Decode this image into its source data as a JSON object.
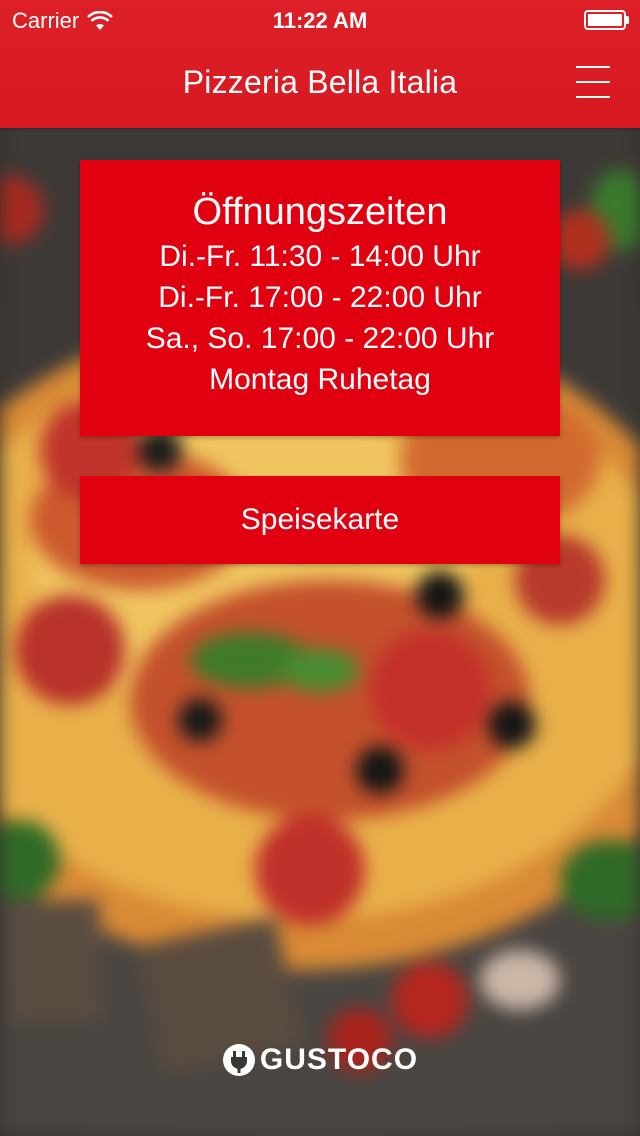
{
  "status_bar": {
    "carrier": "Carrier",
    "time": "11:22 AM"
  },
  "nav": {
    "title": "Pizzeria Bella Italia",
    "menu_icon": "hamburger-menu-icon"
  },
  "hours": {
    "title": "Öffnungszeiten",
    "lines": [
      "Di.-Fr. 11:30 - 14:00 Uhr",
      "Di.-Fr. 17:00 - 22:00 Uhr",
      "Sa., So. 17:00 - 22:00 Uhr",
      "Montag Ruhetag"
    ]
  },
  "menu_button": {
    "label": "Speisekarte"
  },
  "footer": {
    "brand": "GUSTOCO"
  },
  "colors": {
    "nav_red": "#dd1f27",
    "card_red": "#e1000f"
  }
}
